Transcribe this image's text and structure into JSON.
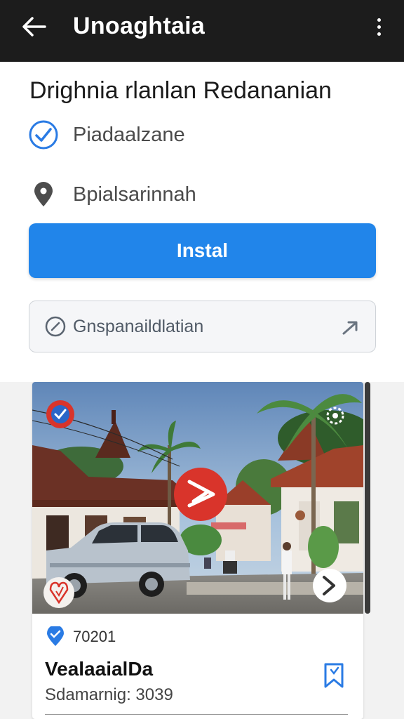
{
  "topbar": {
    "title": "Unoaghtaia",
    "back_icon": "arrow-left-icon",
    "more_icon": "more-vertical-icon"
  },
  "heading": "Drighnia rlanlan Redananian",
  "rows": [
    {
      "icon": "check-circle-icon",
      "label": "Piadaalzane",
      "icon_color": "#2a7be4"
    },
    {
      "icon": "location-pin-icon",
      "label": "Bpialsarinnah",
      "icon_color": "#4d4d4d"
    }
  ],
  "install_button": {
    "label": "Instal",
    "color": "#2185ea"
  },
  "option_row": {
    "icon": "clock-icon",
    "label": "Gnspanaildlatian",
    "arrow_icon": "arrow-right-icon"
  },
  "card": {
    "photo_badges": {
      "top_left": "verified-badge-icon",
      "center": "play-button-icon",
      "bottom_left": "heart-icon",
      "bottom_right": "chevron-right-icon",
      "top_right": "settings-icon"
    },
    "meta_number": "70201",
    "meta_icon": "location-pin-icon",
    "title": "VealaaialDa",
    "subtitle": "Sdamarnig: 3039",
    "bookmark_icon": "bookmark-icon"
  },
  "colors": {
    "accent": "#2185ea",
    "topbar": "#1c1c1c",
    "badge_red": "#d9342b"
  }
}
